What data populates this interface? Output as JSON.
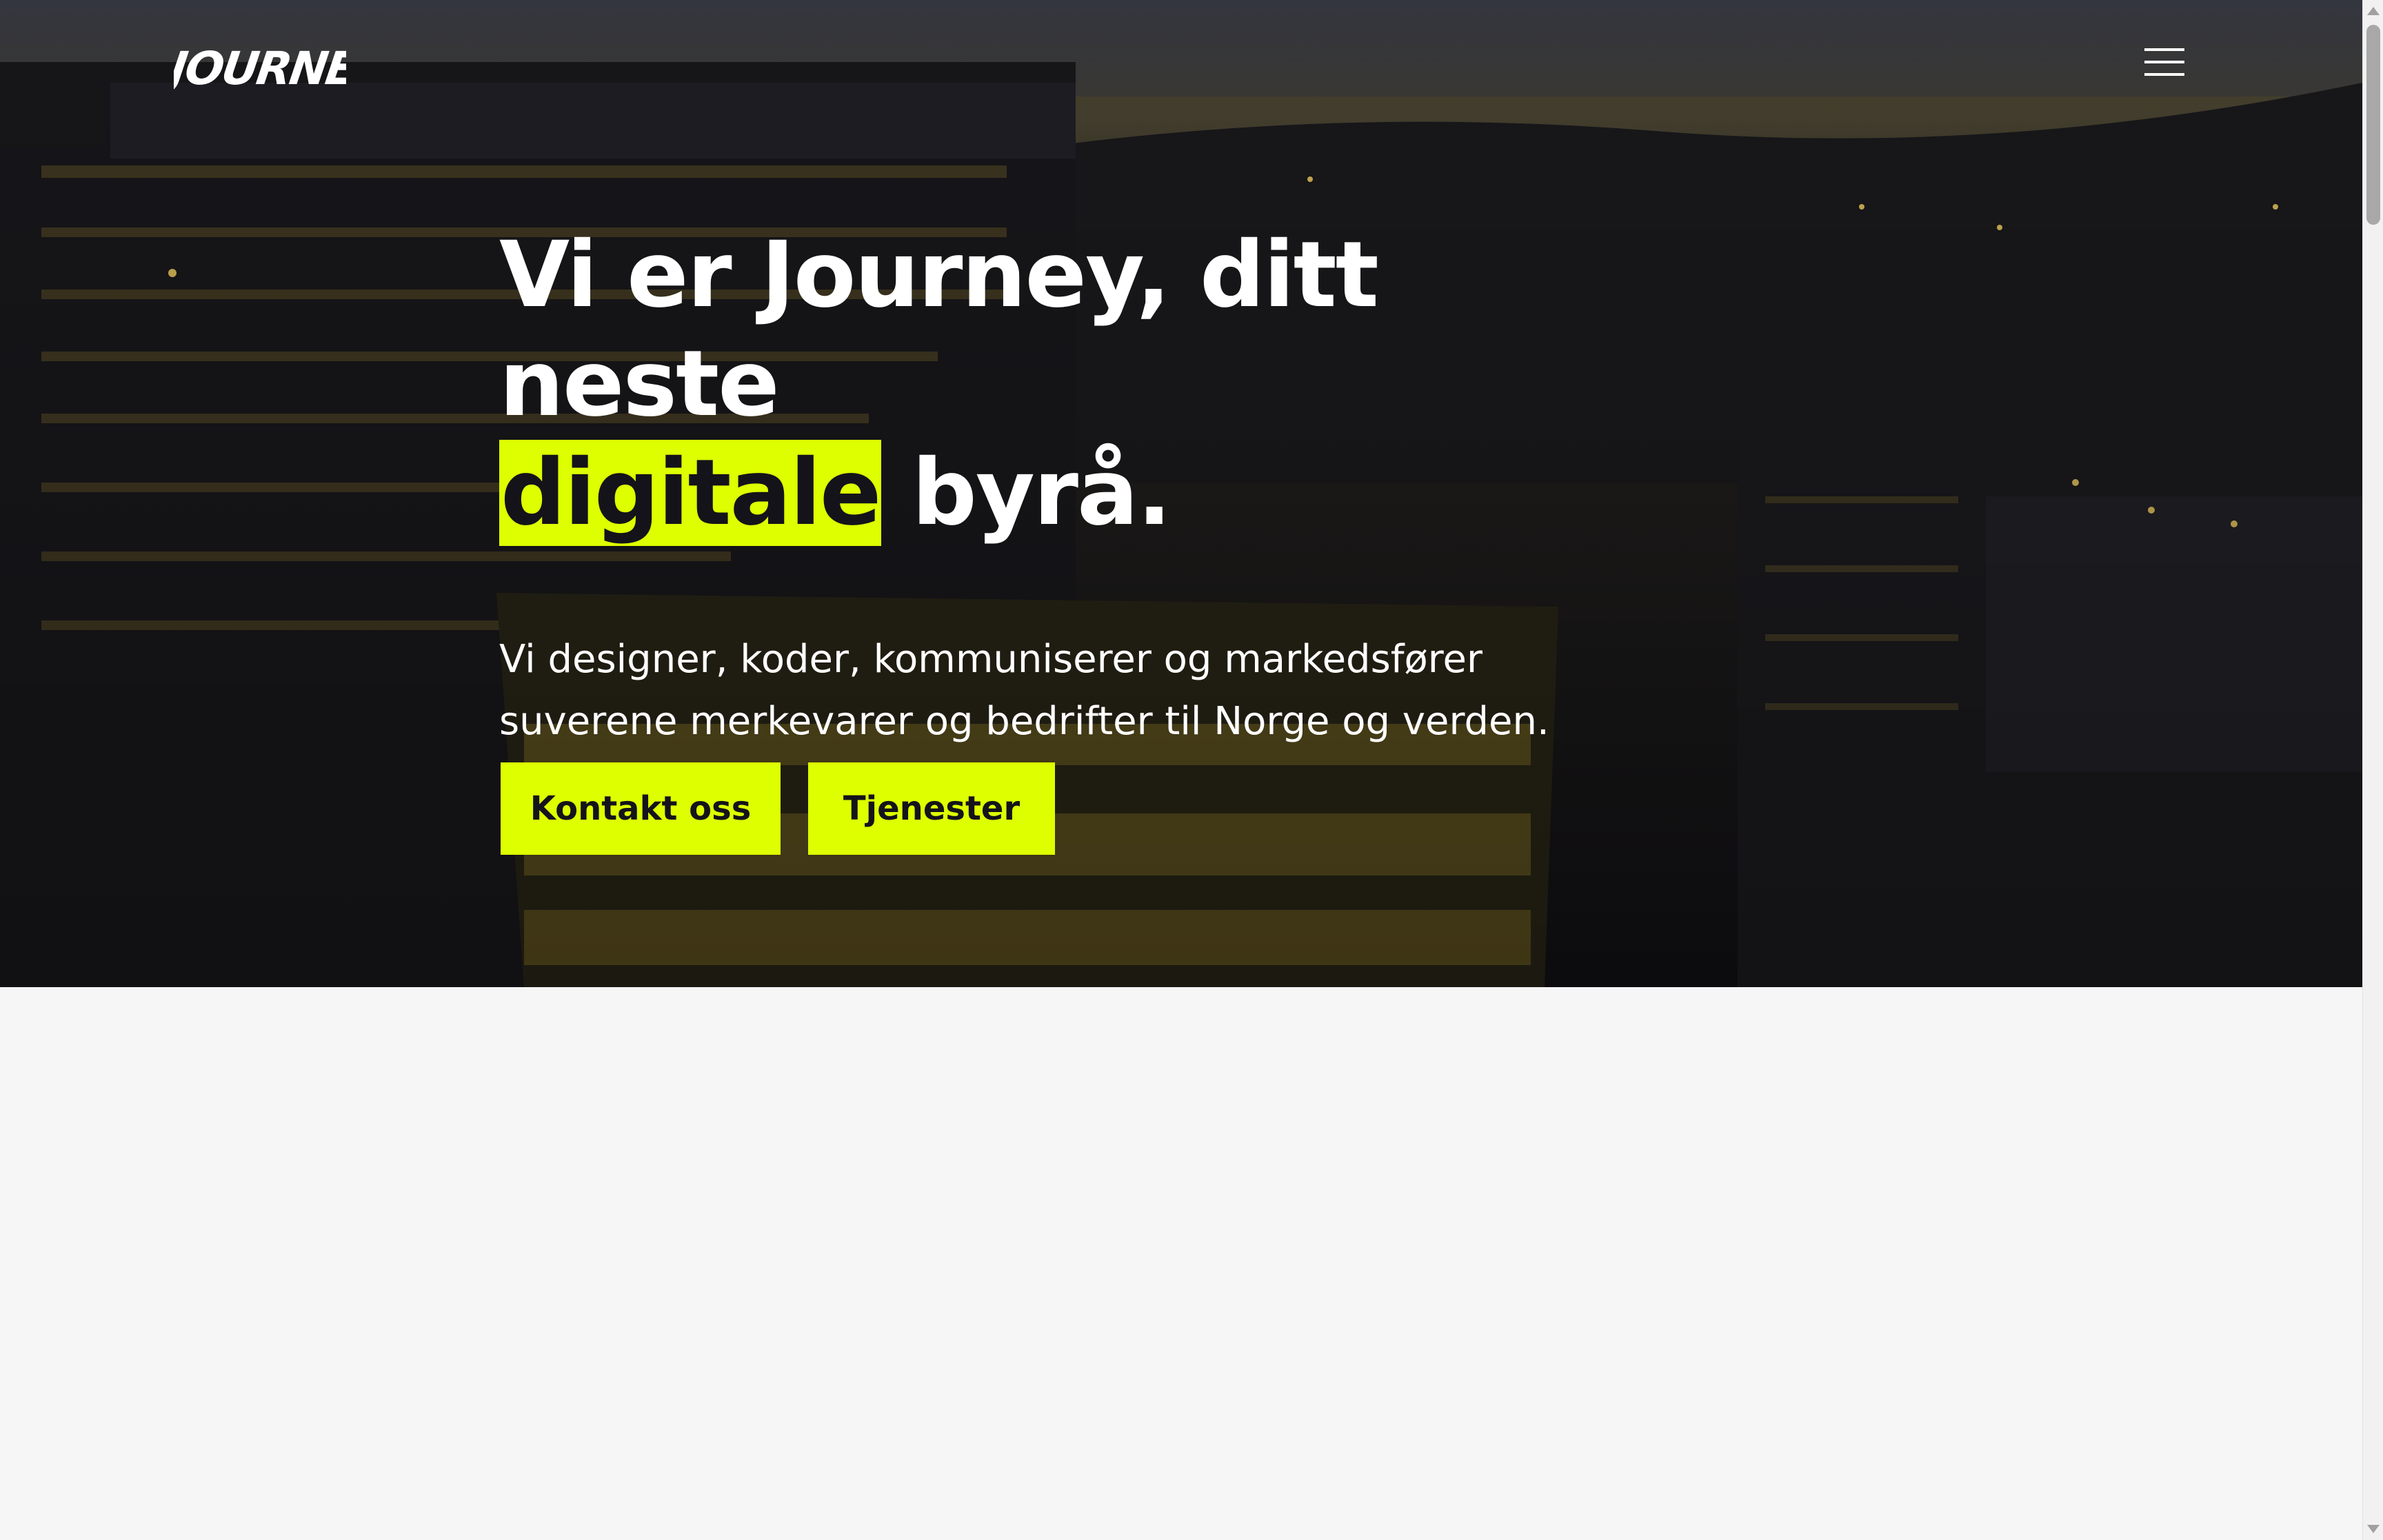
{
  "brand": {
    "logo_text": "JOURNEY",
    "accent_color": "#ddff00",
    "dark_color": "#14131a"
  },
  "header": {
    "menu_icon": "hamburger-menu-icon"
  },
  "hero": {
    "headline_part1": "Vi er Journey, ditt neste",
    "headline_highlight": "digitale",
    "headline_part2": " byrå.",
    "subtext": "Vi designer, koder, kommuniserer og markedsfører suverene merkevarer og bedrifter til Norge og verden.",
    "buttons": [
      {
        "label": "Kontakt oss"
      },
      {
        "label": "Tjenester"
      }
    ]
  },
  "scrollbar": {
    "up_icon": "scroll-up-arrow-icon",
    "down_icon": "scroll-down-arrow-icon"
  }
}
